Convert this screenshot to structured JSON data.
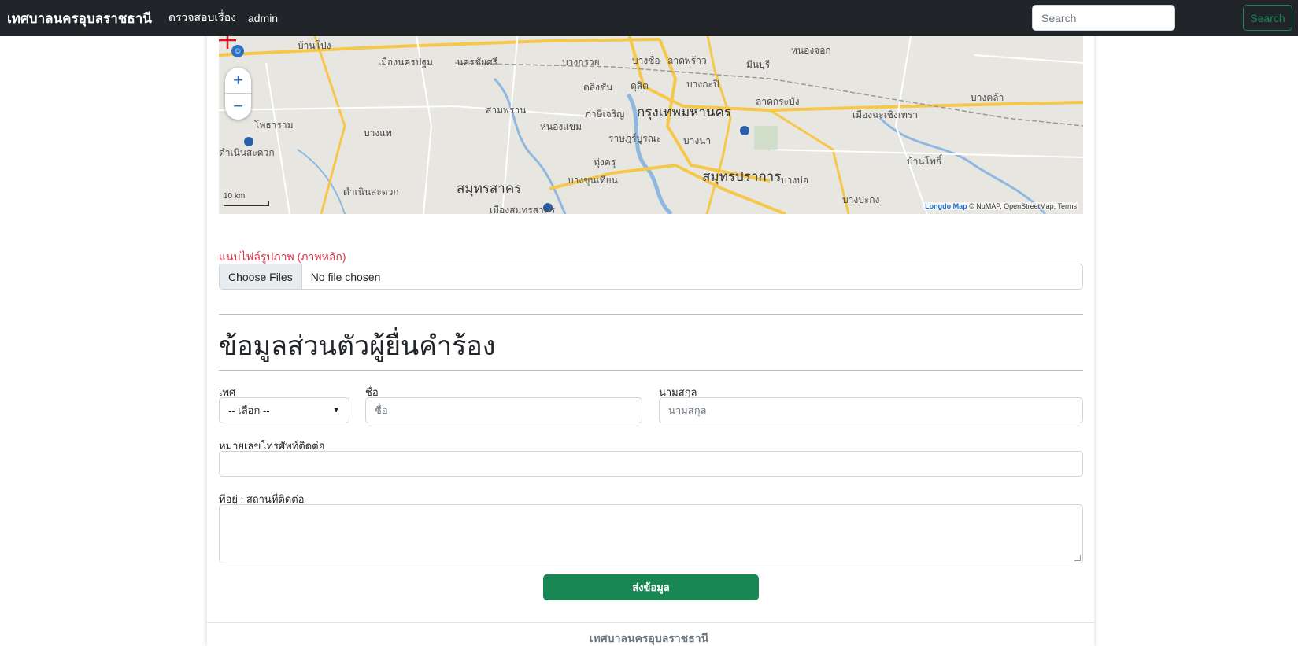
{
  "navbar": {
    "brand": "เทศบาลนครอุบลราชธานี",
    "links": [
      "ตรวจสอบเรื่อง",
      "admin"
    ],
    "search_placeholder": "Search",
    "search_button": "Search"
  },
  "map": {
    "labels": [
      "บ้านโป่ง",
      "เมืองนครปฐม",
      "นครชัยศรี",
      "บางกรวย",
      "บางซื่อ",
      "ลาดพร้าว",
      "มีนบุรี",
      "หนองจอก",
      "ตลิ่งชัน",
      "ดุสิต",
      "บางกะปิ",
      "สามพราน",
      "ภาษีเจริญ",
      "กรุงเทพมหานคร",
      "ลาดกระบัง",
      "เมืองฉะเชิงเทรา",
      "บางคล้า",
      "โพธาราม",
      "บางแพ",
      "หนองแขม",
      "ราษฎร์บูรณะ",
      "บางนา",
      "ทุ่งครุ",
      "สมุทรปราการ",
      "บางบ่อ",
      "บ้านโพธิ์",
      "ดำเนินสะดวก",
      "สมุทรสาคร",
      "บางขุนเทียน",
      "บางปะกง",
      "เมืองสมุทรสาคร",
      "ดำเนินสะดวก"
    ],
    "scale": "10 km",
    "attribution_brand": "Longdo Map",
    "attribution_text": "© NuMAP, OpenStreetMap, Terms",
    "zoom_in": "+",
    "zoom_out": "−"
  },
  "upload": {
    "label": "แนบไฟล์รูปภาพ (ภาพหลัก)",
    "button": "Choose Files",
    "status": "No file chosen"
  },
  "personal": {
    "title": "ข้อมูลส่วนตัวผู้ยื่นคำร้อง",
    "gender_label": "เพศ",
    "gender_value": "-- เลือก --",
    "first_name_label": "ชื่อ",
    "first_name_placeholder": "ชื่อ",
    "last_name_label": "นามสกุล",
    "last_name_placeholder": "นามสกุล",
    "phone_label": "หมายเลขโทรศัพท์ติดต่อ",
    "address_label": "ที่อยู่ : สถานที่ติดต่อ"
  },
  "submit_label": "ส่งข้อมูล",
  "footer": "เทศบาลนครอุบลราชธานี"
}
